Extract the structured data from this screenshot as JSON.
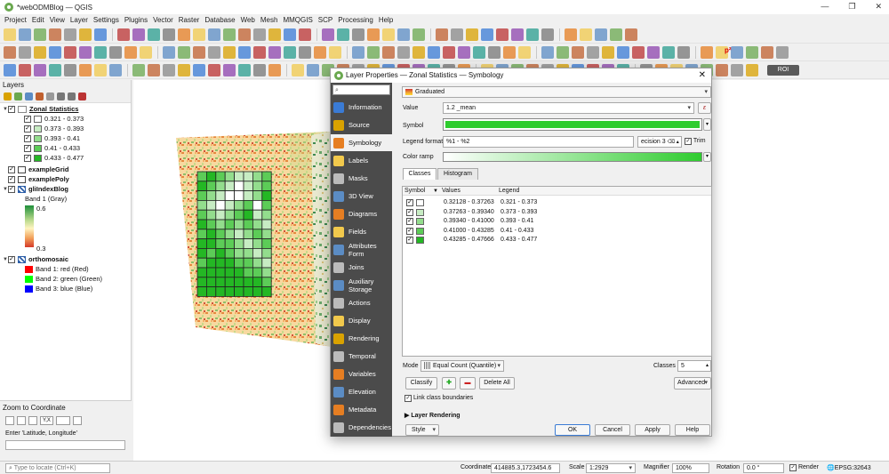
{
  "window": {
    "title": "*webODMBlog — QGIS",
    "controls": [
      "—",
      "❐",
      "✕"
    ]
  },
  "menu": [
    "Project",
    "Edit",
    "View",
    "Layer",
    "Settings",
    "Plugins",
    "Vector",
    "Raster",
    "Database",
    "Web",
    "Mesh",
    "MMQGIS",
    "SCP",
    "Processing",
    "Help"
  ],
  "toolbar": {
    "roi_label": "ROI",
    "p2_label": "p²"
  },
  "layers_panel": {
    "title": "Layers",
    "layers": [
      {
        "name": "Zonal Statistics",
        "classes": [
          {
            "label": "0.321 - 0.373",
            "color": "#ffffff"
          },
          {
            "label": "0.373 - 0.393",
            "color": "#c7ecc3"
          },
          {
            "label": "0.393 - 0.41",
            "color": "#93dd8d"
          },
          {
            "label": "0.41 - 0.433",
            "color": "#5ccc57"
          },
          {
            "label": "0.433 - 0.477",
            "color": "#24b724"
          }
        ]
      },
      {
        "name": "exampleGrid"
      },
      {
        "name": "examplePoly"
      },
      {
        "name": "gliIndexBlog",
        "band": "Band 1 (Gray)",
        "max": "0.6",
        "min": "0.3"
      },
      {
        "name": "orthomosaic",
        "bands": [
          {
            "label": "Band 1: red (Red)",
            "color": "#ff0000"
          },
          {
            "label": "Band 2: green (Green)",
            "color": "#00ff00"
          },
          {
            "label": "Band 3: blue (Blue)",
            "color": "#0000ff"
          }
        ]
      }
    ]
  },
  "zoom_coord": {
    "title": "Zoom to Coordinate",
    "xy_label": "Y,X",
    "hint": "Enter 'Latitude, Longitude'"
  },
  "statusbar": {
    "locator_placeholder": "Type to locate (Ctrl+K)",
    "coordinate_label": "Coordinate",
    "coordinate_value": "414885.3,1723454.6",
    "scale_label": "Scale",
    "scale_value": "1:2929",
    "magnifier_label": "Magnifier",
    "magnifier_value": "100%",
    "rotation_label": "Rotation",
    "rotation_value": "0.0 °",
    "render_label": "Render",
    "crs": "EPSG:32643"
  },
  "dialog": {
    "title": "Layer Properties — Zonal Statistics — Symbology",
    "search_placeholder": "",
    "sidebar": [
      "Information",
      "Source",
      "Symbology",
      "Labels",
      "Masks",
      "3D View",
      "Diagrams",
      "Fields",
      "Attributes Form",
      "Joins",
      "Auxiliary Storage",
      "Actions",
      "Display",
      "Rendering",
      "Temporal",
      "Variables",
      "Elevation",
      "Metadata",
      "Dependencies"
    ],
    "renderer": "Graduated",
    "value_label": "Value",
    "value": "1.2  _mean",
    "symbol_label": "Symbol",
    "legend_format_label": "Legend format",
    "legend_format": "%1 - %2",
    "precision_label": "ecision 3",
    "trim_label": "Trim",
    "color_ramp_label": "Color ramp",
    "tabs": [
      "Classes",
      "Histogram"
    ],
    "columns": [
      "Symbol",
      "Values",
      "Legend"
    ],
    "classes": [
      {
        "values": "0.32128 - 0.37263",
        "legend": "0.321 - 0.373",
        "color": "#ffffff"
      },
      {
        "values": "0.37263 - 0.39340",
        "legend": "0.373 - 0.393",
        "color": "#c7ecc3"
      },
      {
        "values": "0.39340 - 0.41000",
        "legend": "0.393 - 0.41",
        "color": "#93dd8d"
      },
      {
        "values": "0.41000 - 0.43285",
        "legend": "0.41 - 0.433",
        "color": "#5ccc57"
      },
      {
        "values": "0.43285 - 0.47666",
        "legend": "0.433 - 0.477",
        "color": "#24b724"
      }
    ],
    "mode_label": "Mode",
    "mode": "Equal Count (Quantile)",
    "classes_label": "Classes",
    "classes_count": "5",
    "classify_button": "Classify",
    "delete_all_button": "Delete All",
    "advanced_button": "Advanced",
    "link_boundaries_label": "Link class boundaries",
    "layer_rendering_label": "Layer Rendering",
    "style_button": "Style",
    "ok_button": "OK",
    "cancel_button": "Cancel",
    "apply_button": "Apply",
    "help_button": "Help"
  },
  "colors": {
    "accent_green": "#2ecc2e",
    "sidebar_bg": "#4b4b4b"
  }
}
